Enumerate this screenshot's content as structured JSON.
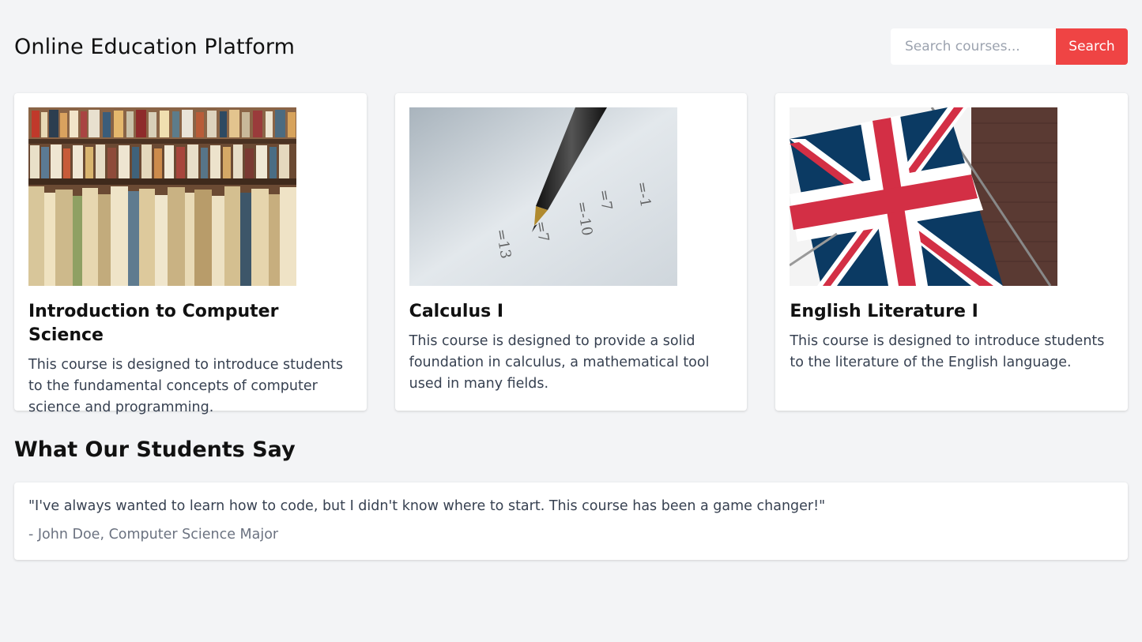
{
  "header": {
    "title": "Online Education Platform",
    "search_placeholder": "Search courses...",
    "search_button": "Search"
  },
  "courses": [
    {
      "title": "Introduction to Computer Science",
      "description": "This course is designed to introduce students to the fundamental concepts of computer science and programming.",
      "image": "bookshelf-photo"
    },
    {
      "title": "Calculus I",
      "description": "This course is designed to provide a solid foundation in calculus, a mathematical tool used in many fields.",
      "image": "pen-on-math-paper-photo"
    },
    {
      "title": "English Literature I",
      "description": "This course is designed to introduce students to the literature of the English language.",
      "image": "union-jack-flag-photo"
    }
  ],
  "testimonials": {
    "heading": "What Our Students Say",
    "items": [
      {
        "quote": "\"I've always wanted to learn how to code, but I didn't know where to start. This course has been a game changer!\"",
        "author": "- John Doe, Computer Science Major"
      }
    ]
  },
  "colors": {
    "background": "#f3f4f6",
    "accent": "#ef4444",
    "card": "#ffffff"
  }
}
